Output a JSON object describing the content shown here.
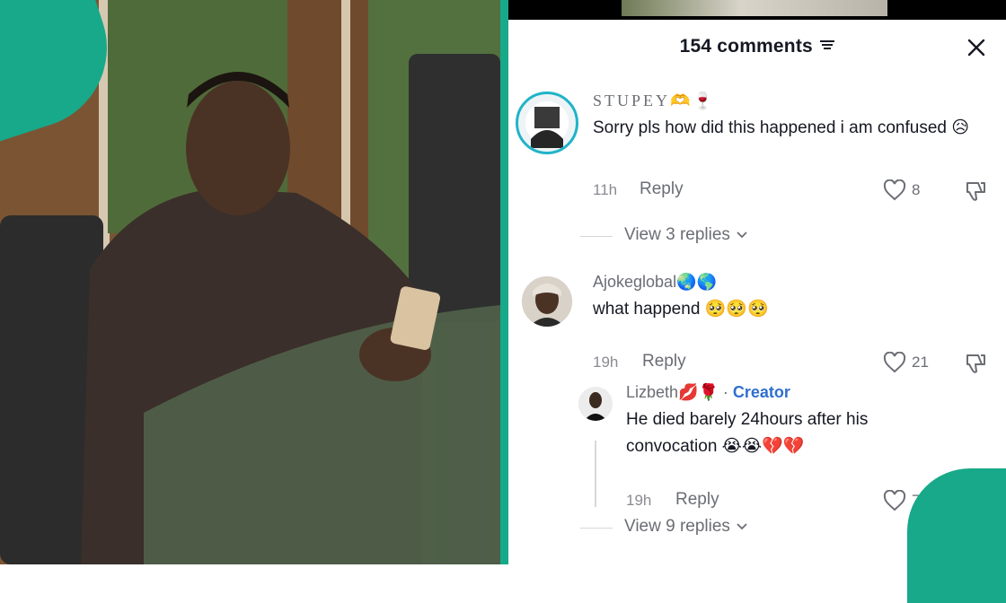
{
  "header": {
    "title": "154 comments"
  },
  "comments": [
    {
      "username": "STUPEY🫶🍷",
      "text": "Sorry pls how did this happened i am confused 😥",
      "time": "11h",
      "reply_label": "Reply",
      "likes": "8",
      "view_replies": "View 3 replies"
    },
    {
      "username": "Ajokeglobal🌏🌎",
      "text": "what happend 🥺🥺🥺",
      "time": "19h",
      "reply_label": "Reply",
      "likes": "21"
    }
  ],
  "reply": {
    "username": "Lizbeth💋🌹",
    "badge_separator": " · ",
    "badge": "Creator",
    "text_line1": "He died barely 24hours after his",
    "text_line2": "convocation 😭😭💔💔",
    "time": "19h",
    "reply_label": "Reply",
    "likes": "74"
  },
  "more_replies": "View 9 replies",
  "colors": {
    "accent": "#17a989",
    "creator": "#2f6fcf",
    "text": "#161823",
    "muted": "#6b6d74"
  }
}
